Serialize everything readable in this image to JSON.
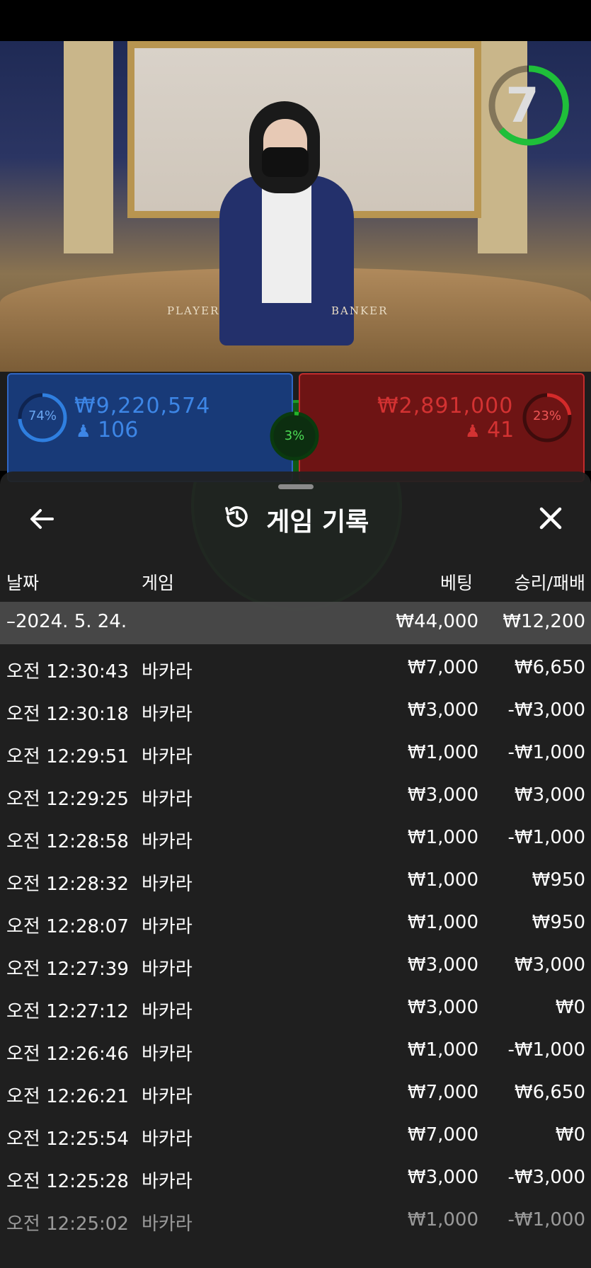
{
  "live": {
    "countdown": "7",
    "table_labels": {
      "player": "PLAYER",
      "banker": "BANKER"
    }
  },
  "betting": {
    "player": {
      "percent": "74%",
      "percent_value": 0.74,
      "amount": "₩9,220,574",
      "players": "106"
    },
    "tie": {
      "percent": "3%",
      "percent_value": 0.03
    },
    "banker": {
      "percent": "23%",
      "percent_value": 0.23,
      "amount": "₩2,891,000",
      "players": "41"
    }
  },
  "colors": {
    "player": "#2f7fe0",
    "banker": "#d42a2a",
    "tie": "#23b42b",
    "sheet": "#212121"
  },
  "history": {
    "title": "게임 기록",
    "icons": {
      "back": "back-arrow-icon",
      "title": "history-clock-icon",
      "close": "close-icon"
    },
    "columns": {
      "date": "날짜",
      "game": "게임",
      "bet": "베팅",
      "result": "승리/패배"
    },
    "summary": {
      "date": "–2024. 5. 24.",
      "bet": "₩44,000",
      "result": "₩12,200"
    },
    "rows": [
      {
        "time": "오전 12:30:43",
        "game": "바카라",
        "bet": "₩7,000",
        "result": "₩6,650"
      },
      {
        "time": "오전 12:30:18",
        "game": "바카라",
        "bet": "₩3,000",
        "result": "-₩3,000"
      },
      {
        "time": "오전 12:29:51",
        "game": "바카라",
        "bet": "₩1,000",
        "result": "-₩1,000"
      },
      {
        "time": "오전 12:29:25",
        "game": "바카라",
        "bet": "₩3,000",
        "result": "₩3,000"
      },
      {
        "time": "오전 12:28:58",
        "game": "바카라",
        "bet": "₩1,000",
        "result": "-₩1,000"
      },
      {
        "time": "오전 12:28:32",
        "game": "바카라",
        "bet": "₩1,000",
        "result": "₩950"
      },
      {
        "time": "오전 12:28:07",
        "game": "바카라",
        "bet": "₩1,000",
        "result": "₩950"
      },
      {
        "time": "오전 12:27:39",
        "game": "바카라",
        "bet": "₩3,000",
        "result": "₩3,000"
      },
      {
        "time": "오전 12:27:12",
        "game": "바카라",
        "bet": "₩3,000",
        "result": "₩0"
      },
      {
        "time": "오전 12:26:46",
        "game": "바카라",
        "bet": "₩1,000",
        "result": "-₩1,000"
      },
      {
        "time": "오전 12:26:21",
        "game": "바카라",
        "bet": "₩7,000",
        "result": "₩6,650"
      },
      {
        "time": "오전 12:25:54",
        "game": "바카라",
        "bet": "₩7,000",
        "result": "₩0"
      },
      {
        "time": "오전 12:25:28",
        "game": "바카라",
        "bet": "₩3,000",
        "result": "-₩3,000"
      },
      {
        "time": "오전 12:25:02",
        "game": "바카라",
        "bet": "₩1,000",
        "result": "-₩1,000"
      }
    ]
  }
}
